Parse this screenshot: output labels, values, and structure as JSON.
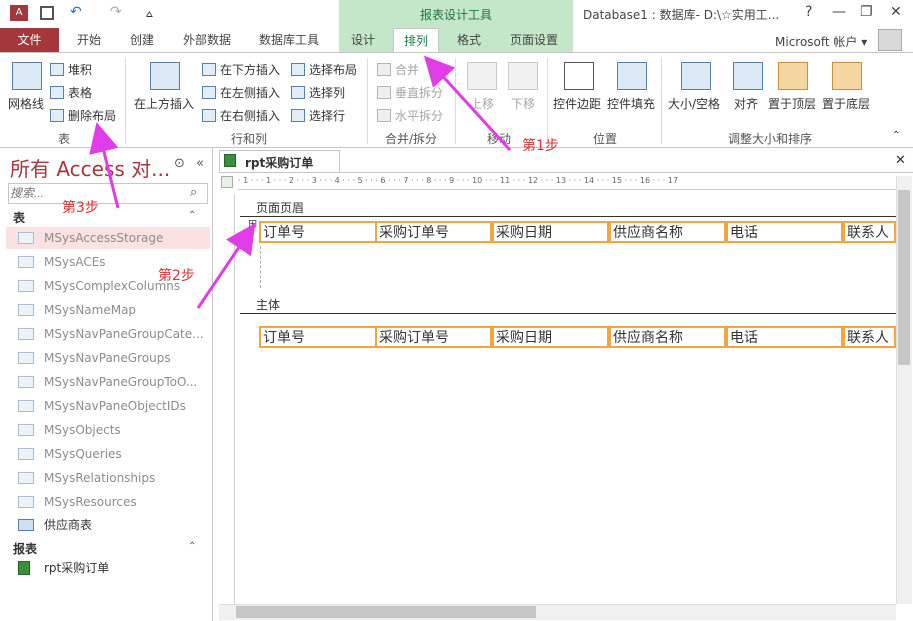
{
  "quick_access": {
    "undo": "↶",
    "redo": "↷",
    "customize": "⩟"
  },
  "window": {
    "context_group_title": "报表设计工具",
    "title": "Database1 : 数据库- D:\\☆实用工...",
    "help": "?",
    "minimize": "—",
    "restore": "❐",
    "close": "✕"
  },
  "tabs": {
    "file": "文件",
    "items": [
      "开始",
      "创建",
      "外部数据",
      "数据库工具",
      "设计",
      "排列",
      "格式",
      "页面设置"
    ],
    "active": "排列",
    "account": "Microsoft 帐户 ▾"
  },
  "ribbon": {
    "table_group": {
      "label": "表",
      "gridlines": "网格线",
      "stacked": "堆积",
      "tabular": "表格",
      "remove_layout": "删除布局"
    },
    "rows_cols_group": {
      "label": "行和列",
      "insert_above": "在上方插入",
      "insert_below": "在下方插入",
      "insert_left": "在左侧插入",
      "insert_right": "在右侧插入",
      "select_layout": "选择布局",
      "select_column": "选择列",
      "select_row": "选择行"
    },
    "merge_group": {
      "label": "合并/拆分",
      "merge": "合并",
      "split_vertical": "垂直拆分",
      "split_horizontal": "水平拆分"
    },
    "move_group": {
      "label": "移动",
      "move_up": "上移",
      "move_down": "下移"
    },
    "position_group": {
      "label": "位置",
      "control_margins": "控件边距",
      "control_padding": "控件填充"
    },
    "sizing_group": {
      "label": "调整大小和排序",
      "size_space": "大小/空格",
      "align": "对齐",
      "bring_front": "置于顶层",
      "send_back": "置于底层"
    }
  },
  "nav": {
    "title": "所有 Access 对...",
    "search_placeholder": "搜索...",
    "tables_header": "表",
    "tables": [
      "MSysAccessStorage",
      "MSysACEs",
      "MSysComplexColumns",
      "MSysNameMap",
      "MSysNavPaneGroupCate...",
      "MSysNavPaneGroups",
      "MSysNavPaneGroupToO...",
      "MSysNavPaneObjectIDs",
      "MSysObjects",
      "MSysQueries",
      "MSysRelationships",
      "MSysResources",
      "供应商表"
    ],
    "reports_header": "报表",
    "reports": [
      "rpt采购订单"
    ]
  },
  "document": {
    "tab_label": "rpt采购订单",
    "page_header": "页面页眉",
    "detail": "主体",
    "header_fields": [
      "订单号",
      "采购订单号",
      "采购日期",
      "供应商名称",
      "电话",
      "联系人"
    ],
    "detail_fields": [
      "订单号",
      "采购订单号",
      "采购日期",
      "供应商名称",
      "电话",
      "联系人"
    ]
  },
  "annotations": {
    "step1": "第1步",
    "step2": "第2步",
    "step3": "第3步",
    "color": "#e03ce8"
  }
}
